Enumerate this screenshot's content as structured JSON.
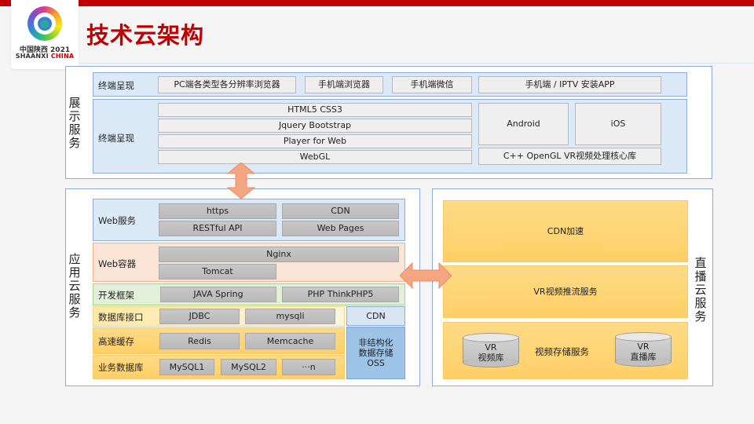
{
  "header": {
    "title": "技术云架构",
    "logo": {
      "line1": "中国陕西 2021",
      "line2_a": "SHAANXI",
      "line2_b": "CHINA",
      "icon": "games-emblem-icon"
    }
  },
  "colors": {
    "accent": "#c00000",
    "frame_border": "#8eaadb",
    "arrow": "#f4a582"
  },
  "display_service": {
    "label": "展示服务",
    "rows": [
      {
        "label": "终端呈现",
        "items": [
          "PC端各类型各分辨率浏览器",
          "手机端浏览器",
          "手机端微信",
          "手机端 / IPTV 安装APP"
        ]
      },
      {
        "label": "终端呈现",
        "stack": [
          "HTML5   CSS3",
          "Jquery   Bootstrap",
          "Player for Web",
          "WebGL"
        ],
        "native": [
          "Android",
          "iOS"
        ],
        "core_lib": "C++ OpenGL VR视频处理核心库"
      }
    ]
  },
  "app_service": {
    "label": "应用云服务",
    "layers": [
      {
        "label": "Web服务",
        "items": [
          "https",
          "CDN",
          "RESTful API",
          "Web Pages"
        ]
      },
      {
        "label": "Web容器",
        "items": [
          "Nginx",
          "Tomcat"
        ]
      },
      {
        "label": "开发框架",
        "items": [
          "JAVA Spring",
          "PHP ThinkPHP5"
        ]
      },
      {
        "label": "数据库接口",
        "items": [
          "JDBC",
          "mysqli"
        ]
      },
      {
        "label": "高速缓存",
        "items": [
          "Redis",
          "Memcache"
        ]
      },
      {
        "label": "业务数据库",
        "items": [
          "MySQL1",
          "MySQL2",
          "···n"
        ]
      }
    ],
    "side": {
      "cdn": "CDN",
      "oss": "非结构化\n数据存储\nOSS"
    }
  },
  "live_service": {
    "label": "直播云服务",
    "blocks": [
      "CDN加速",
      "VR视频推流服务",
      "视频存储服务"
    ],
    "databases": [
      "VR\n视频库",
      "VR\n直播库"
    ]
  }
}
